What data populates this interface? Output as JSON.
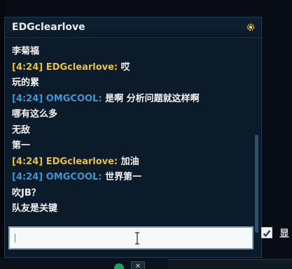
{
  "window": {
    "title": "EDGclearlove"
  },
  "messages": [
    {
      "ts": "",
      "name": "",
      "text": "李菊福",
      "color": ""
    },
    {
      "ts": "[4:24] ",
      "name": "EDGclearlove: ",
      "text": "哎",
      "color": "yellow"
    },
    {
      "ts": "",
      "name": "",
      "text": "玩的累",
      "color": ""
    },
    {
      "ts": "[4:24] ",
      "name": "OMGCOOL: ",
      "text": "是啊 分析问题就这样啊",
      "color": "blue"
    },
    {
      "ts": "",
      "name": "",
      "text": "哪有这么多",
      "color": ""
    },
    {
      "ts": "",
      "name": "",
      "text": "无敌",
      "color": ""
    },
    {
      "ts": "",
      "name": "",
      "text": "第一",
      "color": ""
    },
    {
      "ts": "[4:24] ",
      "name": "EDGclearlove: ",
      "text": "加油",
      "color": "yellow"
    },
    {
      "ts": "[4:24] ",
      "name": "OMGCOOL: ",
      "text": "世界第一",
      "color": "blue"
    },
    {
      "ts": "",
      "name": "",
      "text": "吹JB？",
      "color": ""
    },
    {
      "ts": "",
      "name": "",
      "text": "队友是关键",
      "color": ""
    }
  ],
  "input": {
    "value": ""
  },
  "checkbox": {
    "label": "显",
    "checked": true
  },
  "colors": {
    "yellow": "#e6c23c",
    "blue": "#3a98d6",
    "background": "#0c1b29"
  },
  "icons": {
    "settings": "gear-icon",
    "cursor": "text-cursor-icon",
    "check": "checkmark-icon"
  }
}
